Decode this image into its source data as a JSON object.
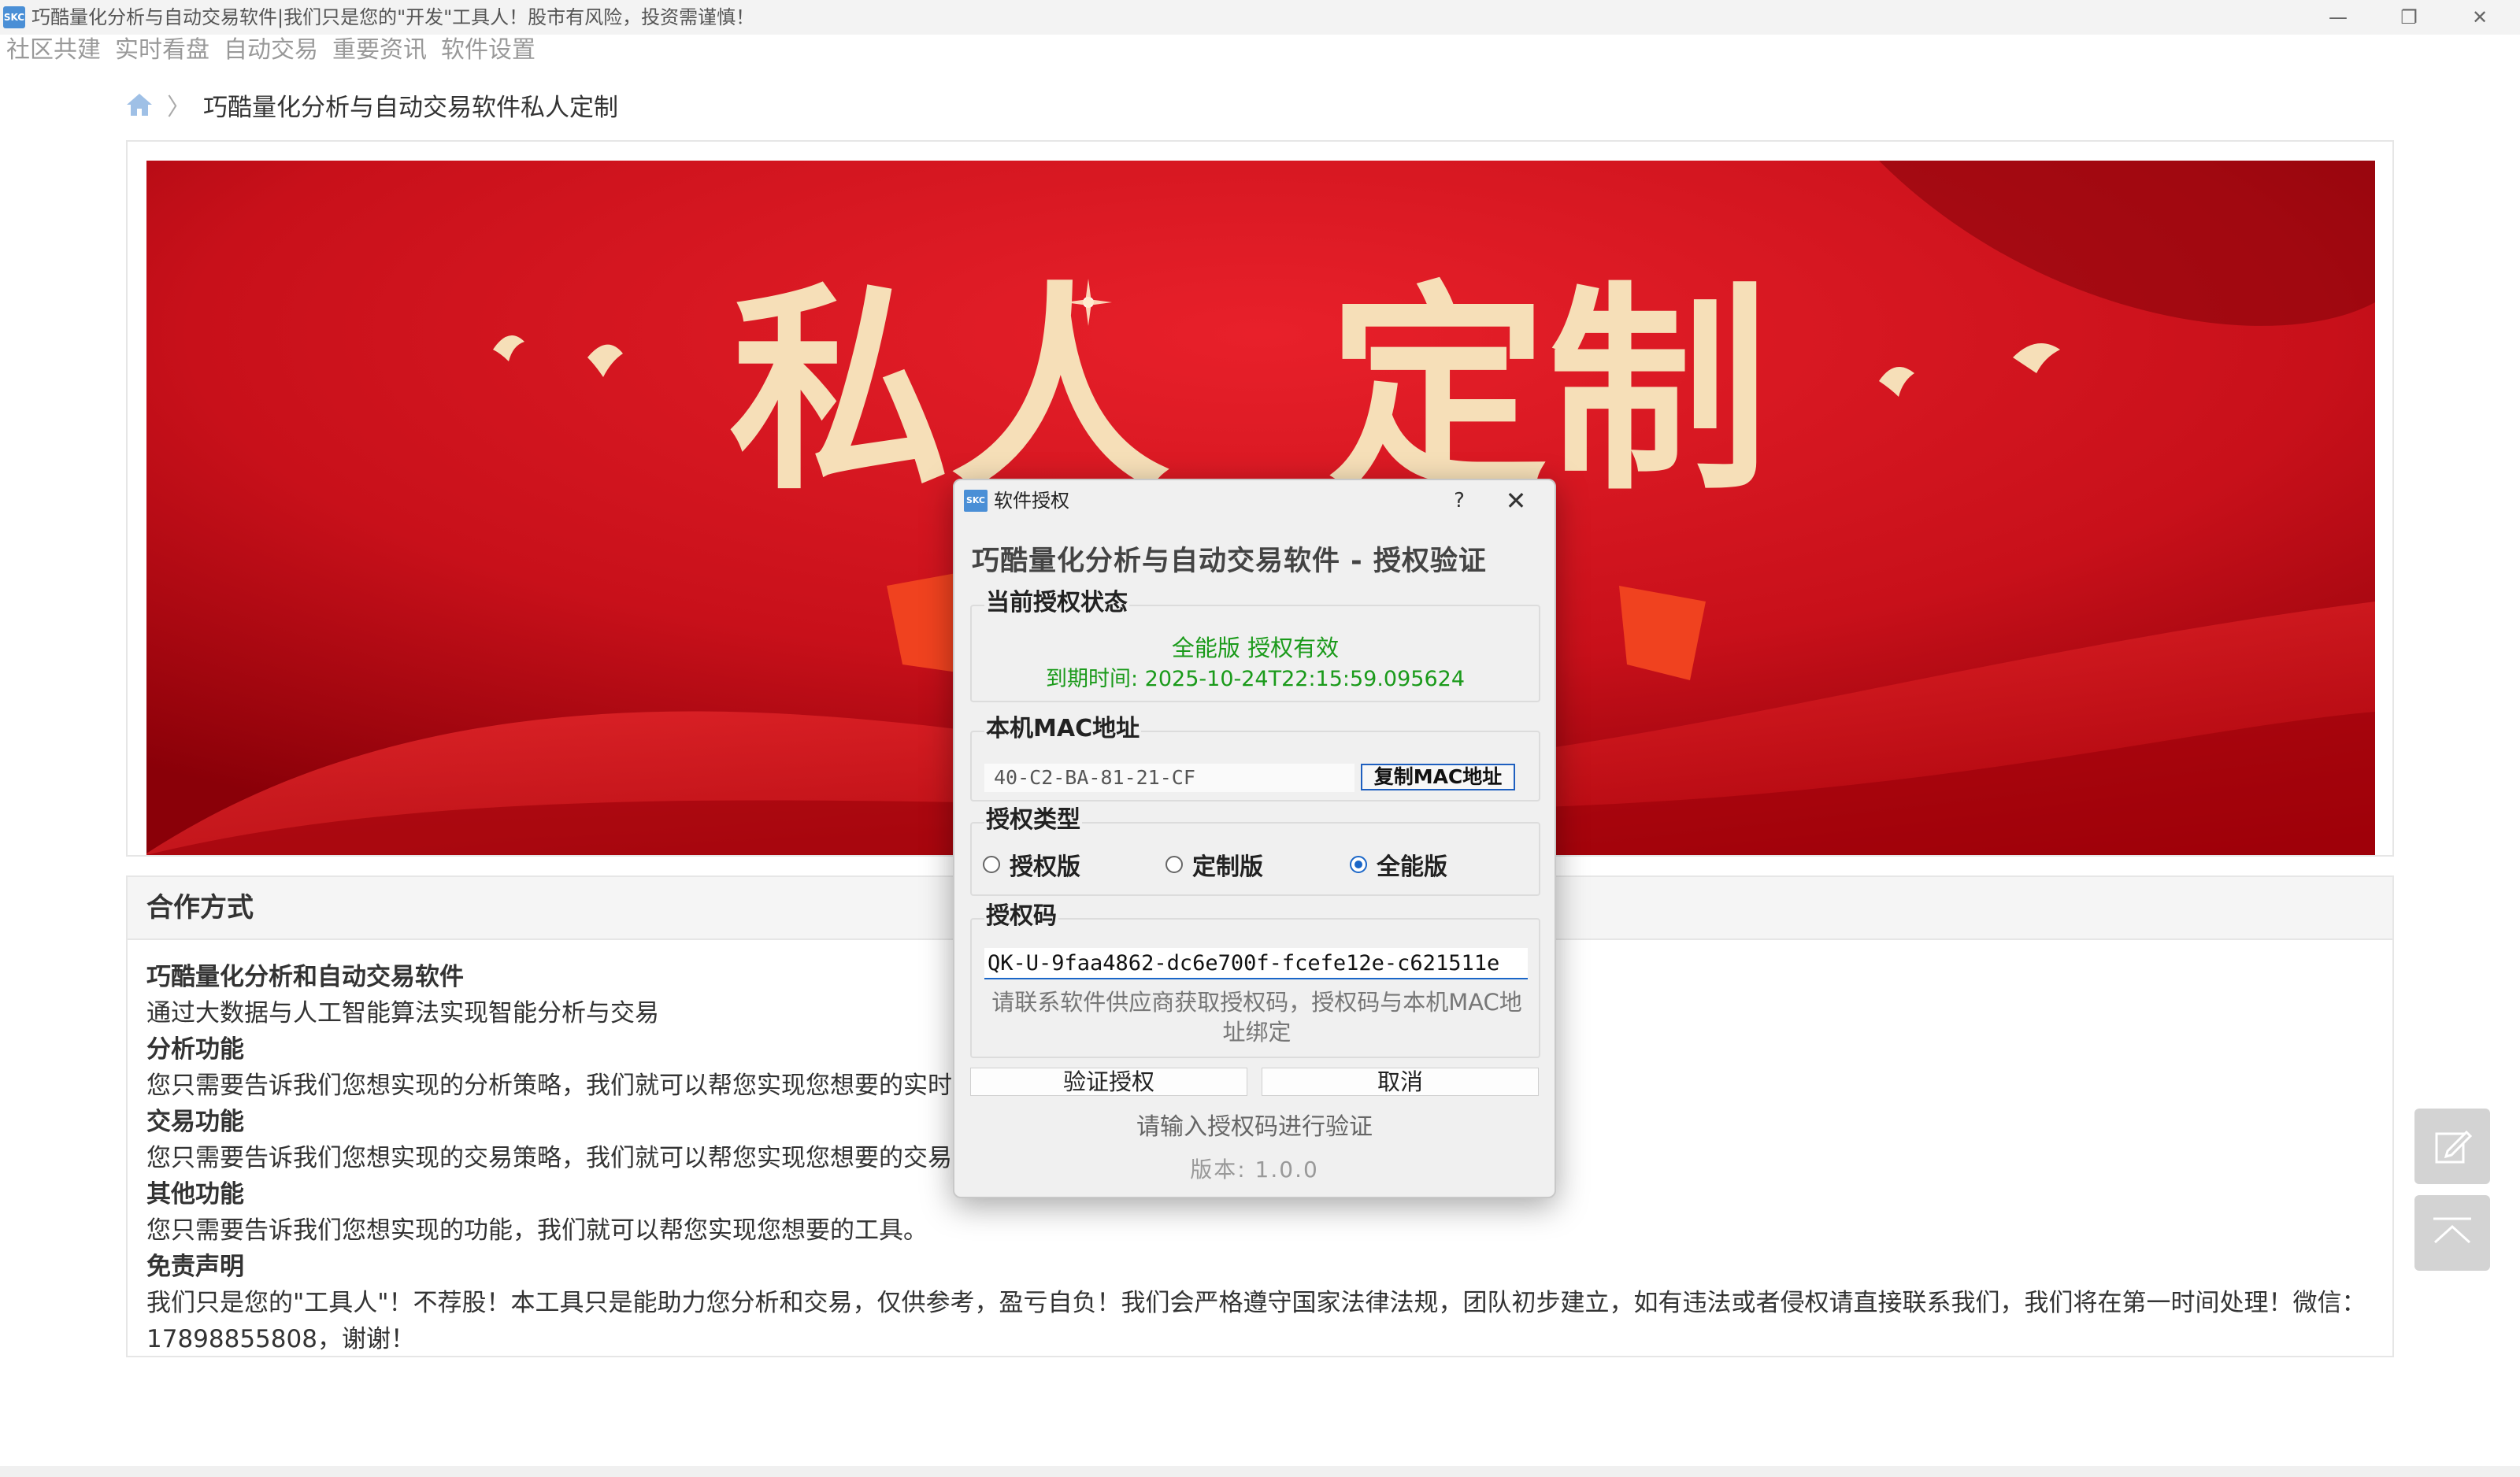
{
  "window": {
    "app_icon_text": "SKC",
    "title": "巧酷量化分析与自动交易软件|我们只是您的\"开发\"工具人！股市有风险，投资需谨慎！",
    "minimize": "—",
    "maximize": "❐",
    "close": "✕"
  },
  "menu": [
    "社区共建",
    "实时看盘",
    "自动交易",
    "重要资讯",
    "软件设置"
  ],
  "breadcrumb": {
    "separator": "〉",
    "title": "巧酷量化分析与自动交易软件私人定制"
  },
  "banner": {
    "text_left": "私人",
    "text_right": "定制",
    "colors": {
      "background": "#c8101a",
      "dark": "#8a0008",
      "text": "#f6dfb8"
    }
  },
  "cooperation": {
    "header": "合作方式",
    "lines": [
      {
        "text": "巧酷量化分析和自动交易软件",
        "bold": true
      },
      {
        "text": "通过大数据与人工智能算法实现智能分析与交易",
        "bold": false
      },
      {
        "text": "分析功能",
        "bold": true
      },
      {
        "text": "您只需要告诉我们您想实现的分析策略，我们就可以帮您实现您想要的实时",
        "bold": false
      },
      {
        "text": "交易功能",
        "bold": true
      },
      {
        "text": "您只需要告诉我们您想实现的交易策略，我们就可以帮您实现您想要的交易",
        "bold": false
      },
      {
        "text": "其他功能",
        "bold": true
      },
      {
        "text": "您只需要告诉我们您想实现的功能，我们就可以帮您实现您想要的工具。",
        "bold": false
      },
      {
        "text": "免责声明",
        "bold": true
      }
    ],
    "disclaimer": "我们只是您的\"工具人\"！不荐股！本工具只是能助力您分析和交易，仅供参考，盈亏自负！我们会严格遵守国家法律法规，团队初步建立，如有违法或者侵权请直接联系我们，我们将在第一时间处理！微信：17898855808，谢谢！"
  },
  "floating": {
    "edit_icon": "edit-icon",
    "top_icon": "back-to-top-icon"
  },
  "dialog": {
    "icon_text": "SKC",
    "title": "软件授权",
    "help": "?",
    "close": "✕",
    "heading": "巧酷量化分析与自动交易软件 - 授权验证",
    "status": {
      "group_title": "当前授权状态",
      "line1": "全能版 授权有效",
      "line2": "到期时间: 2025-10-24T22:15:59.095624",
      "color": "#1a9a1a"
    },
    "mac": {
      "group_title": "本机MAC地址",
      "value": "40-C2-BA-81-21-CF",
      "copy_button": "复制MAC地址"
    },
    "license_type": {
      "group_title": "授权类型",
      "options": [
        "授权版",
        "定制版",
        "全能版"
      ],
      "selected": "全能版"
    },
    "code": {
      "group_title": "授权码",
      "value": "QK-U-9faa4862-dc6e700f-fcefe12e-c621511e",
      "hint": "请联系软件供应商获取授权码，授权码与本机MAC地址绑定"
    },
    "buttons": {
      "verify": "验证授权",
      "cancel": "取消"
    },
    "message": "请输入授权码进行验证",
    "version": "版本: 1.0.0"
  }
}
